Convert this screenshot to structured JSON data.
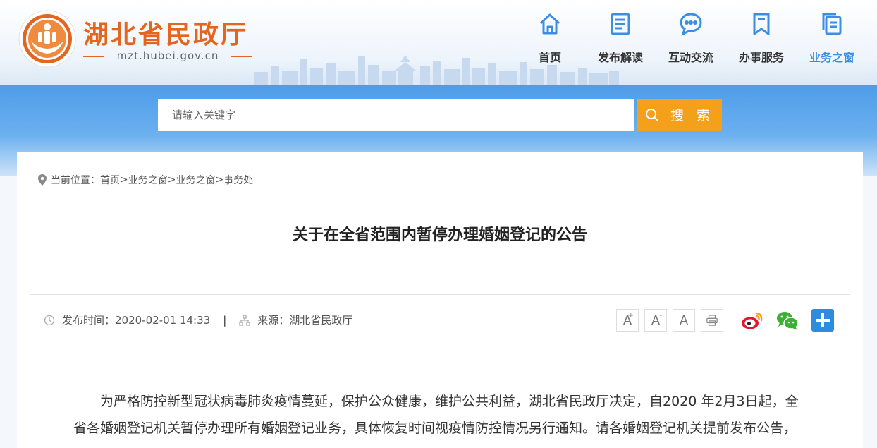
{
  "site": {
    "title": "湖北省民政厅",
    "url": "mzt.hubei.gov.cn"
  },
  "nav": {
    "items": [
      {
        "label": "首页",
        "icon": "home-icon"
      },
      {
        "label": "发布解读",
        "icon": "document-icon"
      },
      {
        "label": "互动交流",
        "icon": "chat-bubble-icon"
      },
      {
        "label": "办事服务",
        "icon": "bookmark-icon"
      },
      {
        "label": "业务之窗",
        "icon": "copy-document-icon",
        "active": true
      }
    ],
    "active_color": "#3a8ee6"
  },
  "search": {
    "placeholder": "请输入关键字",
    "button_label": "搜 索",
    "button_color": "#f5a01a"
  },
  "breadcrumb": {
    "prefix": "当前位置：",
    "items": [
      "首页",
      "业务之窗",
      "业务之窗",
      "事务处"
    ],
    "separator": ">"
  },
  "article": {
    "title": "关于在全省范围内暂停办理婚姻登记的公告",
    "publish_label": "发布时间：",
    "publish_time": "2020-02-01 14:33",
    "meta_separator": "|",
    "source_label": "来源：",
    "source": "湖北省民政厅",
    "body": "为严格防控新型冠状病毒肺炎疫情蔓延，保护公众健康，维护公共利益，湖北省民政厅决定，自2020 年2月3日起，全省各婚姻登记机关暂停办理所有婚姻登记业务，具体恢复时间视疫情防控情况另行通知。请各婚姻登记机关提前发布公告，并做好解释工作。"
  },
  "tools": {
    "font_large": "A",
    "font_large_sup": "+",
    "font_small": "A",
    "font_small_sup": "-",
    "font_normal": "A"
  },
  "colors": {
    "brand_orange": "#e4651f",
    "band_blue": "#4d9ce9",
    "weibo": "#e6162d",
    "wechat": "#3cb034",
    "share_more": "#2d8be0"
  }
}
